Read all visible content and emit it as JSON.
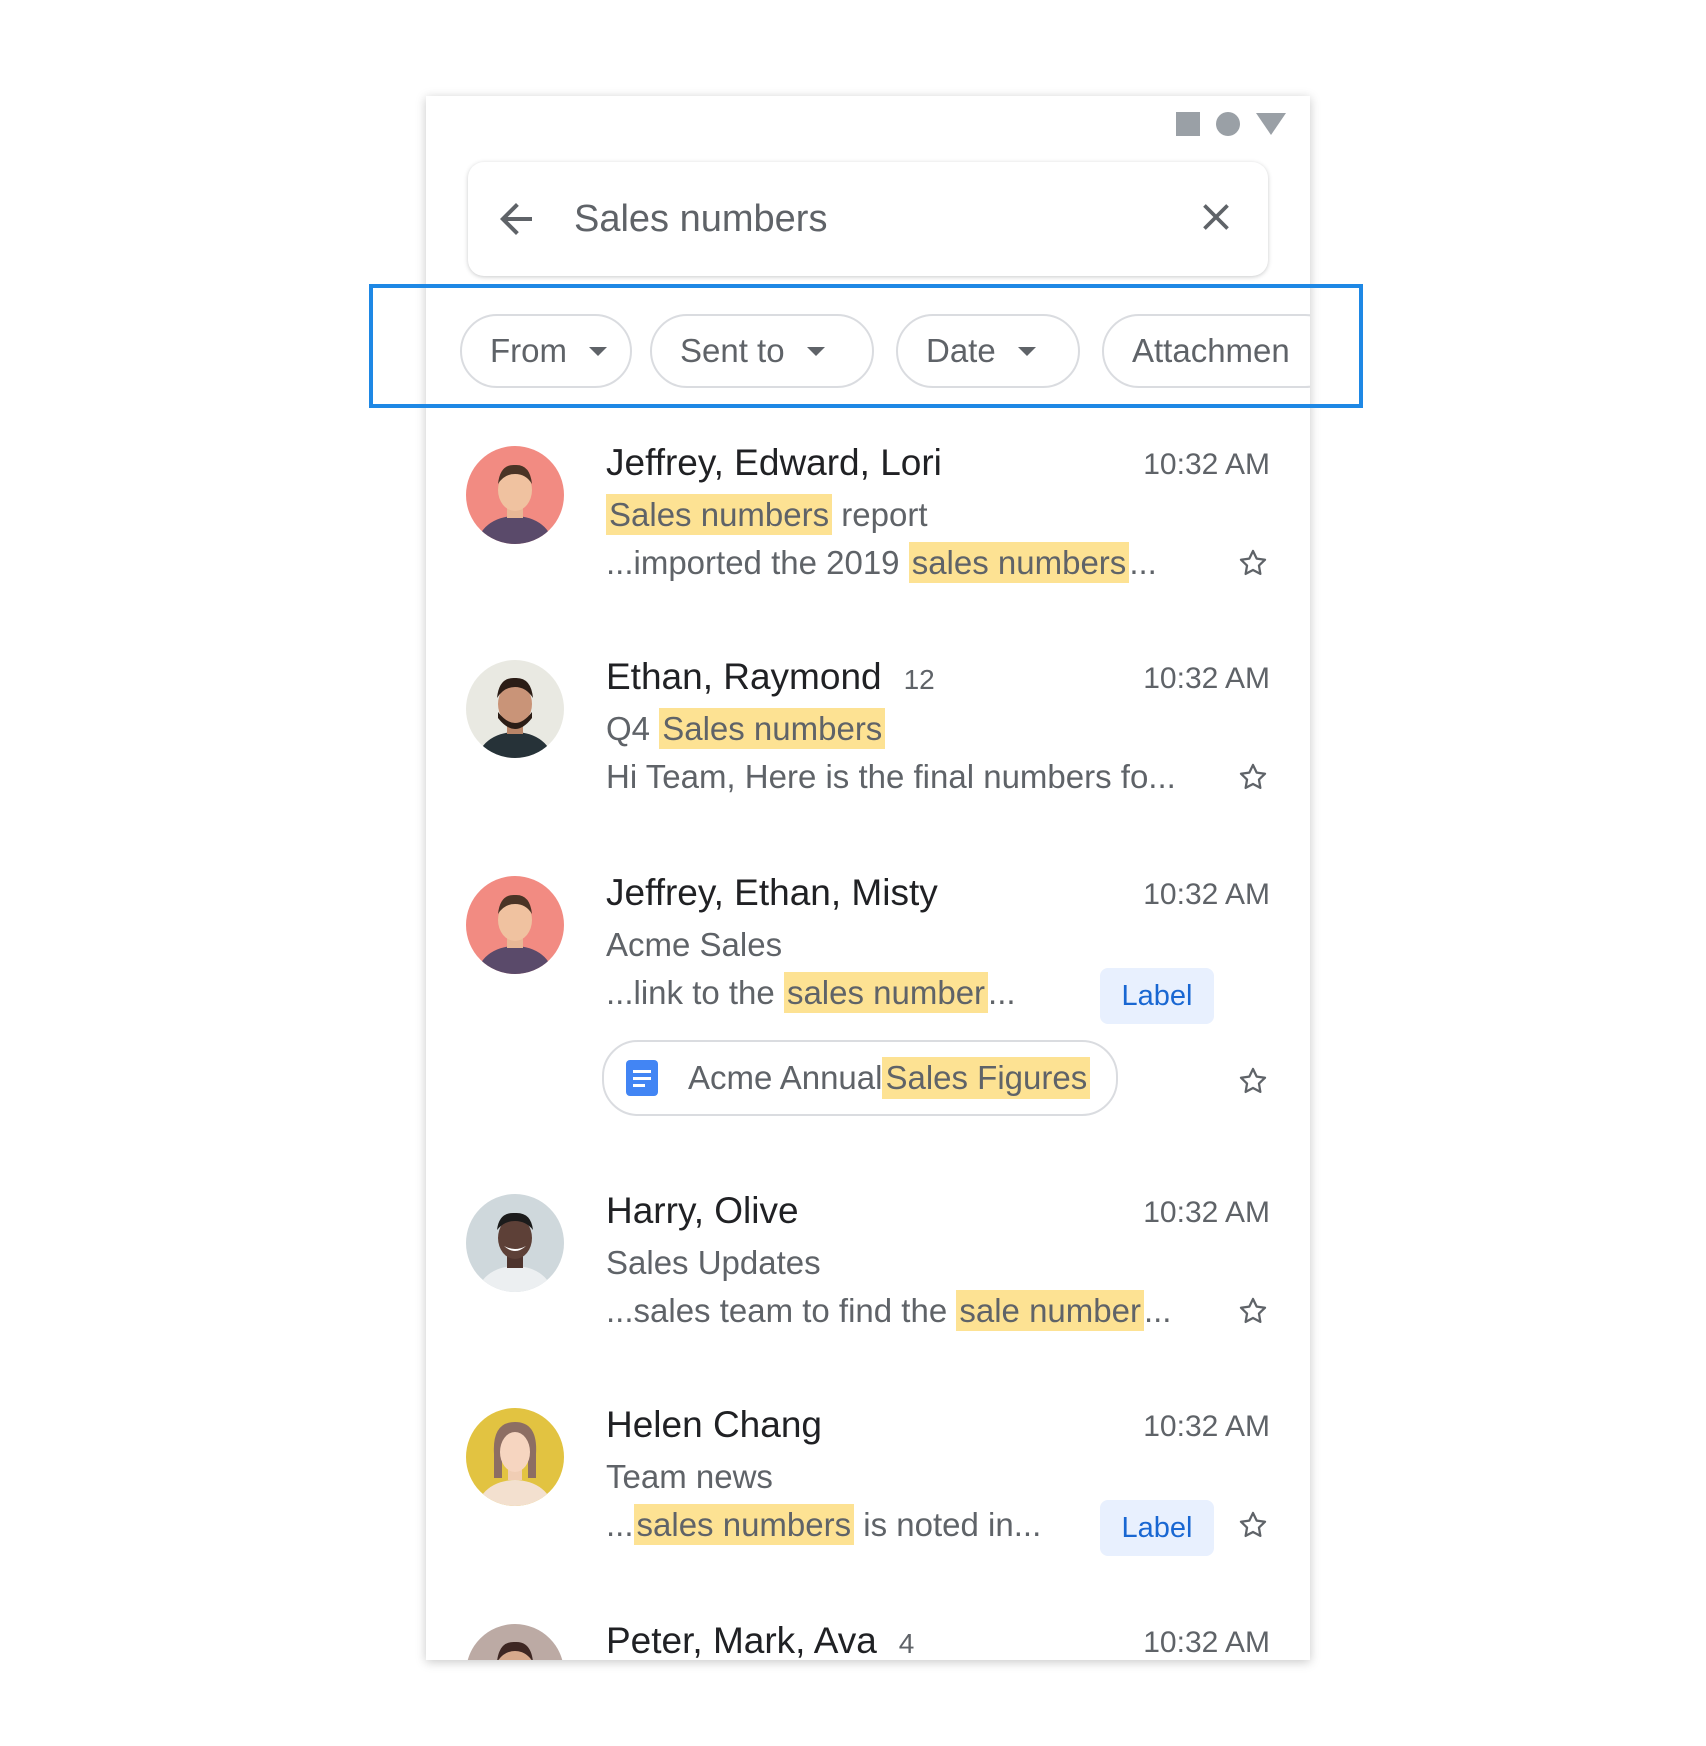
{
  "status_icons": [
    "square-icon",
    "circle-icon",
    "triangle-icon"
  ],
  "search": {
    "query": "Sales numbers"
  },
  "chips": [
    {
      "label": "From"
    },
    {
      "label": "Sent to"
    },
    {
      "label": "Date"
    },
    {
      "label": "Attachmen"
    }
  ],
  "emails": [
    {
      "sender": "Jeffrey, Edward, Lori",
      "count": "",
      "time": "10:32 AM",
      "subject": {
        "highlight": "Sales numbers",
        "rest": " report"
      },
      "snippet": {
        "pre": "...imported the 2019 ",
        "highlight": "sales numbers",
        "post": "..."
      }
    },
    {
      "sender": "Ethan, Raymond",
      "count": "12",
      "time": "10:32 AM",
      "subject": {
        "pre": "Q4 ",
        "highlight": "Sales numbers"
      },
      "snippet": {
        "text": "Hi Team, Here is the final numbers fo..."
      }
    },
    {
      "sender": "Jeffrey, Ethan, Misty",
      "count": "",
      "time": "10:32 AM",
      "subject": {
        "text": "Acme Sales"
      },
      "snippet": {
        "pre": "...link to the ",
        "highlight": "sales number",
        "post": "..."
      },
      "label": "Label",
      "attachment": {
        "pre": "Acme Annual ",
        "highlight": "Sales Figures"
      }
    },
    {
      "sender": "Harry, Olive",
      "count": "",
      "time": "10:32 AM",
      "subject": {
        "text": "Sales Updates"
      },
      "snippet": {
        "pre": "...sales team to find the ",
        "highlight": "sale number",
        "post": "..."
      }
    },
    {
      "sender": "Helen Chang",
      "count": "",
      "time": "10:32 AM",
      "subject": {
        "text": "Team news"
      },
      "snippet": {
        "pre": "...",
        "highlight": "sales numbers",
        "post": " is noted in..."
      },
      "label": "Label"
    },
    {
      "sender": "Peter, Mark, Ava",
      "count": "4",
      "time": "10:32 AM"
    }
  ],
  "colors": {
    "highlight": "#fde293",
    "accent_frame": "#1e88e5",
    "label_bg": "#e8f0fe",
    "label_text": "#1967d2"
  }
}
